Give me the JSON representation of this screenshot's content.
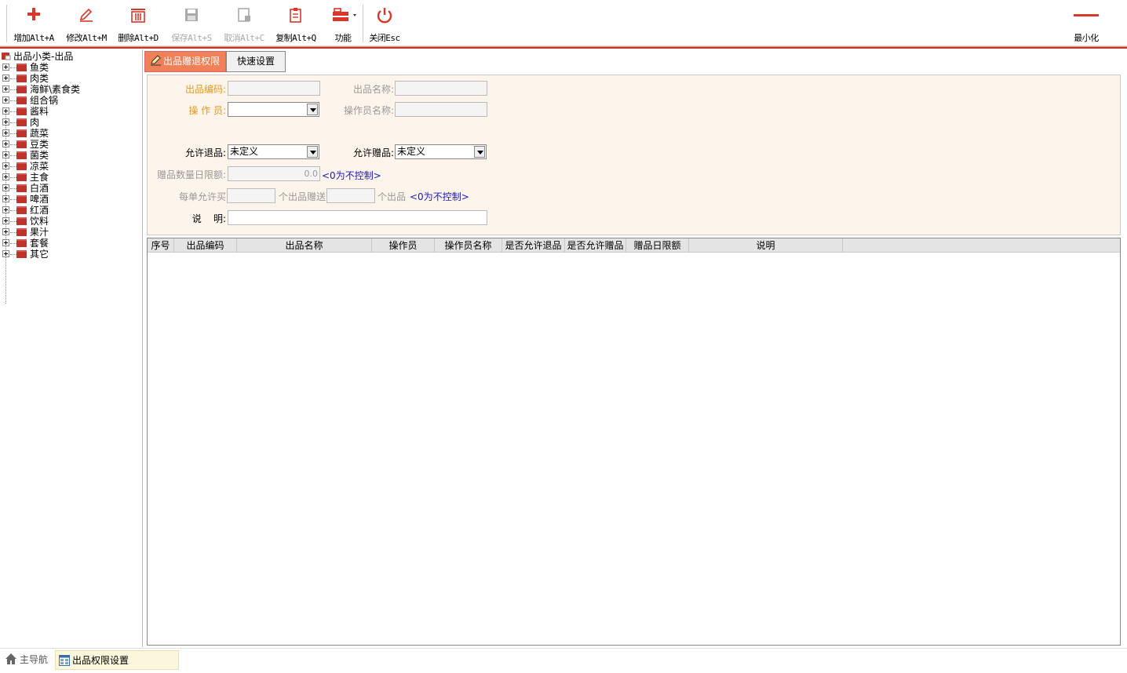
{
  "toolbar": {
    "buttons": [
      {
        "label": "增加Alt+A",
        "icon": "plus-icon",
        "enabled": true
      },
      {
        "label": "修改Alt+M",
        "icon": "edit-pencil-icon",
        "enabled": true
      },
      {
        "label": "删除Alt+D",
        "icon": "trash-icon",
        "enabled": true
      },
      {
        "label": "保存Alt+S",
        "icon": "save-disk-icon",
        "enabled": false
      },
      {
        "label": "取消Alt+C",
        "icon": "cancel-icon",
        "enabled": false
      },
      {
        "label": "复制Alt+Q",
        "icon": "copy-clipboard-icon",
        "enabled": true
      },
      {
        "label": "功能",
        "icon": "toolbox-icon",
        "enabled": true
      },
      {
        "label": "关闭Esc",
        "icon": "power-icon",
        "enabled": true
      }
    ],
    "minimize_label": "最小化",
    "accent_color": "#d9372a"
  },
  "tree": {
    "root_label": "出品小类-出品",
    "items": [
      "鱼类",
      "肉类",
      "海鲜\\素食类",
      "组合锅",
      "酱料",
      "肉",
      "蔬菜",
      "豆类",
      "菌类",
      "凉菜",
      "主食",
      "白酒",
      "啤酒",
      "红酒",
      "饮料",
      "果汁",
      "套餐",
      "其它"
    ]
  },
  "tabs": [
    {
      "label": "出品赠退权限",
      "active": true
    },
    {
      "label": "快速设置",
      "active": false
    }
  ],
  "form": {
    "code_label": "出品编码:",
    "code_value": "",
    "name_label": "出品名称:",
    "name_value": "",
    "operator_label": "操 作 员:",
    "operator_value": "",
    "operator_name_label": "操作员名称:",
    "operator_name_value": "",
    "allow_return_label": "允许退品:",
    "allow_return_value": "未定义",
    "allow_gift_label": "允许赠品:",
    "allow_gift_value": "未定义",
    "gift_daily_limit_label": "赠品数量日限额:",
    "gift_daily_limit_value": "0.0",
    "hint_no_control": "<0为不控制>",
    "per_order_label": "每单允许买",
    "per_order_value": "",
    "gift_count_label": "个出品赠送",
    "gift_count_value": "",
    "unit_label": "个出品",
    "hint_no_control_2": "<0为不控制>",
    "note_label": "说    明:",
    "note_value": ""
  },
  "grid": {
    "columns": [
      "序号",
      "出品编码",
      "出品名称",
      "操作员",
      "操作员名称",
      "是否允许退品",
      "是否允许赠品",
      "赠品日限额",
      "说明"
    ],
    "rows": []
  },
  "statusbar": {
    "home_label": "主导航",
    "active_tab_label": "出品权限设置"
  }
}
